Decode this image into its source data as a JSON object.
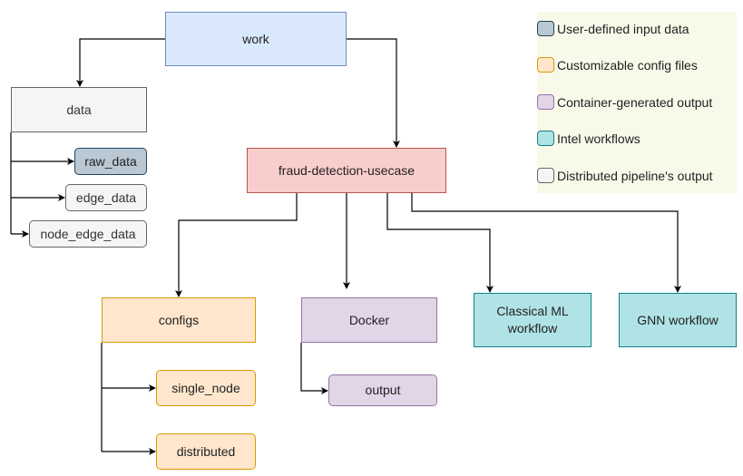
{
  "nodes": {
    "work": "work",
    "data": "data",
    "raw_data": "raw_data",
    "edge_data": "edge_data",
    "node_edge_data": "node_edge_data",
    "fraud": "fraud-detection-usecase",
    "configs": "configs",
    "single_node": "single_node",
    "distributed": "distributed",
    "docker": "Docker",
    "output": "output",
    "classical_line1": "Classical ML",
    "classical_line2": "workflow",
    "gnn": "GNN workflow"
  },
  "legend": [
    {
      "label": "User-defined input data",
      "color": "#bac8d3",
      "border": "#23445d"
    },
    {
      "label": "Customizable config files",
      "color": "#ffe6cc",
      "border": "#d79b00"
    },
    {
      "label": "Container-generated output",
      "color": "#e1d5e7",
      "border": "#9673a6"
    },
    {
      "label": "Intel workflows",
      "color": "#b0e3e6",
      "border": "#0e8088"
    },
    {
      "label": "Distributed pipeline's output",
      "color": "#f5f5f5",
      "border": "#666666"
    }
  ]
}
